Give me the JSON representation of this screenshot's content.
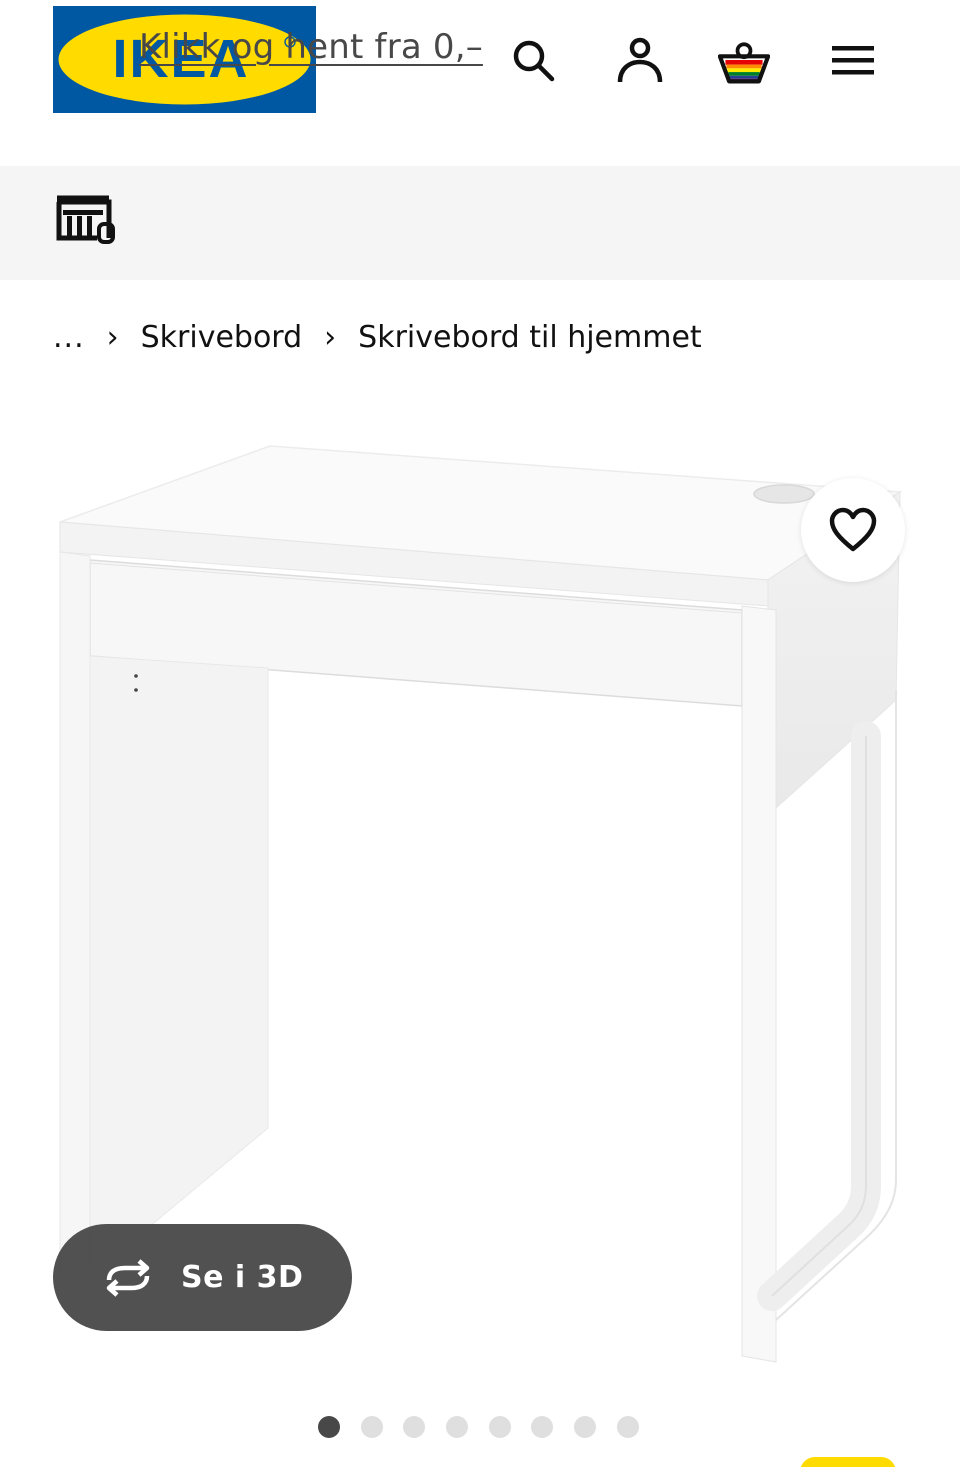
{
  "header": {
    "logo_text": "IKEA",
    "logo_colors": {
      "blue": "#0058a3",
      "yellow": "#ffdb00"
    },
    "icons": [
      "search-icon",
      "profile-icon",
      "cart-icon",
      "menu-icon"
    ]
  },
  "promo": {
    "icon": "store-pickup-icon",
    "text": "Klikk og hent fra 0,–"
  },
  "breadcrumb": {
    "ellipsis": "...",
    "separator": "›",
    "items": [
      "Skrivebord",
      "Skrivebord til hjemmet"
    ]
  },
  "product": {
    "image": "white-desk-with-drawer",
    "favorite_icon": "heart-icon",
    "view_3d_label": "Se i 3D",
    "view_3d_icon": "rotate-icon"
  },
  "carousel": {
    "total_images": 8,
    "active_index": 0
  },
  "colors": {
    "text": "#111111",
    "promo_bg": "#f5f5f5",
    "link": "#484848",
    "dot_active": "#484848",
    "dot_inactive": "#dfdfdf"
  }
}
